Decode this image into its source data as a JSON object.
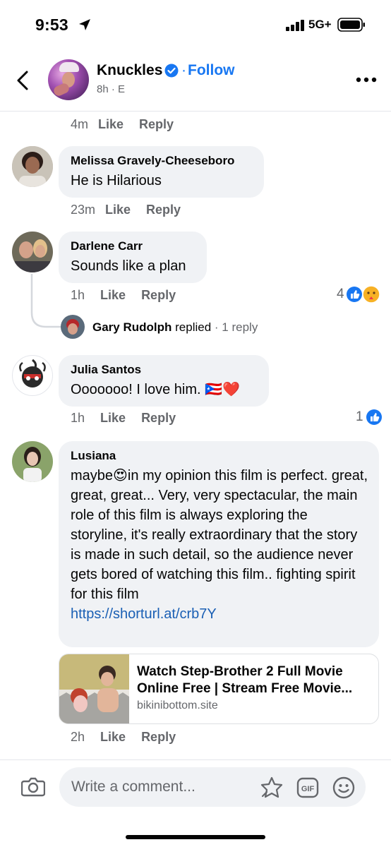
{
  "status_bar": {
    "time": "9:53",
    "network": "5G+"
  },
  "header": {
    "page_name": "Knuckles",
    "separator": "·",
    "follow_label": "Follow",
    "post_meta": "8h · E"
  },
  "comments": [
    {
      "id": "prev",
      "time": "4m",
      "like": "Like",
      "reply": "Reply"
    },
    {
      "id": "melissa",
      "name": "Melissa Gravely-Cheeseboro",
      "text": "He is Hilarious",
      "time": "23m",
      "like": "Like",
      "reply": "Reply"
    },
    {
      "id": "darlene",
      "name": "Darlene Carr",
      "text": "Sounds like a plan",
      "time": "1h",
      "like": "Like",
      "reply": "Reply",
      "reaction_count": "4",
      "reply_preview": {
        "name": "Gary Rudolph",
        "verb": "replied",
        "count": "· 1 reply"
      }
    },
    {
      "id": "julia",
      "name": "Julia Santos",
      "text": "Ooooooo! I love him. 🇵🇷❤️",
      "time": "1h",
      "like": "Like",
      "reply": "Reply",
      "reaction_count": "1"
    },
    {
      "id": "lusiana",
      "name": "Lusiana",
      "text": "maybe😍in my opinion this film is perfect. great, great, great... Very, very spectacular, the main role of this film is always exploring the storyline, it's really extraordinary that the story is made in such detail, so the audience never gets bored of watching this film.. fighting spirit for this film",
      "link": "https://shorturl.at/crb7Y",
      "preview": {
        "title": "Watch Step-Brother 2 Full Movie Online Free | Stream Free Movie...",
        "domain": "bikinibottom.site"
      },
      "time": "2h",
      "like": "Like",
      "reply": "Reply"
    }
  ],
  "composer": {
    "placeholder": "Write a comment..."
  },
  "colors": {
    "accent": "#1877f2",
    "bubble": "#f0f2f5",
    "secondary_text": "#65676b"
  }
}
